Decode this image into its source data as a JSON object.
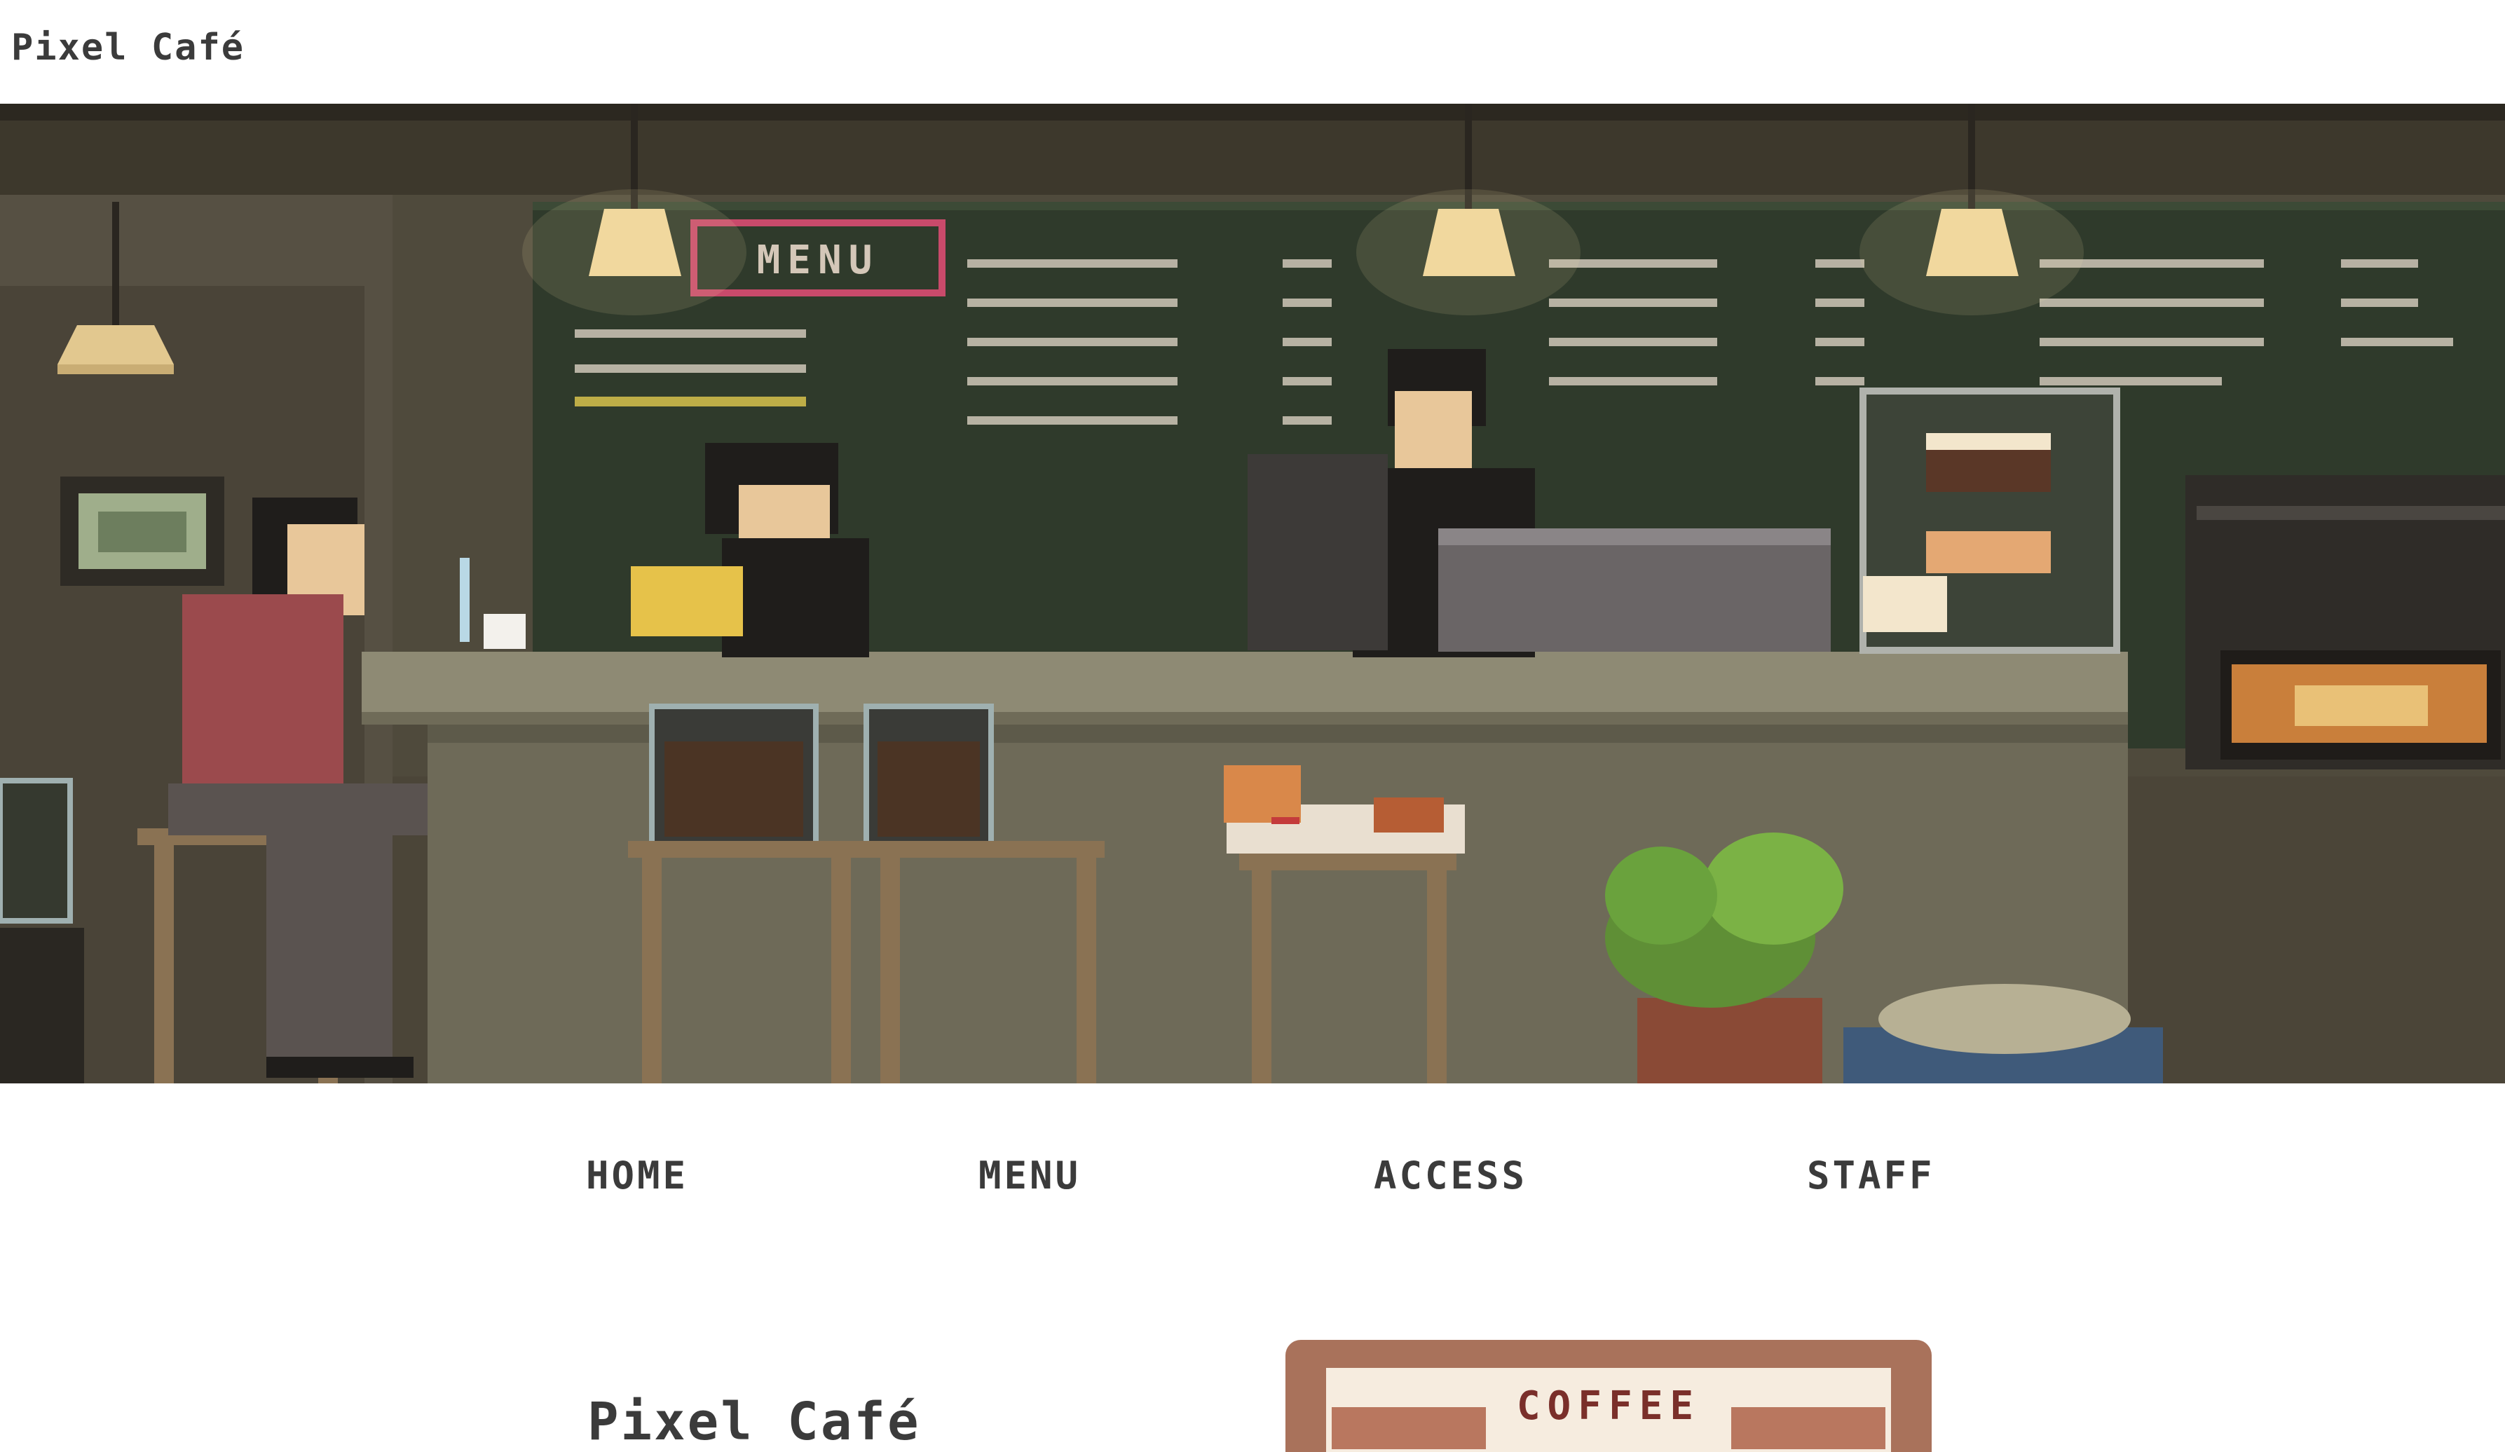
{
  "header": {
    "brand": "Pixel Café"
  },
  "hero": {
    "chalkboard_title": "MENU",
    "icon": "pixel-cafe-illustration"
  },
  "nav": {
    "items": [
      {
        "label": "HOME"
      },
      {
        "label": "MENU"
      },
      {
        "label": "ACCESS"
      },
      {
        "label": "STAFF"
      }
    ]
  },
  "content": {
    "title": "Pixel Café",
    "promo_label": "COFFEE"
  },
  "colors": {
    "wall": "#4b4538",
    "chalkboard": "#2f3a2b",
    "counter": "#8e8a74",
    "accent_pink": "#c94a6b",
    "promo_frame": "#a9725b"
  }
}
